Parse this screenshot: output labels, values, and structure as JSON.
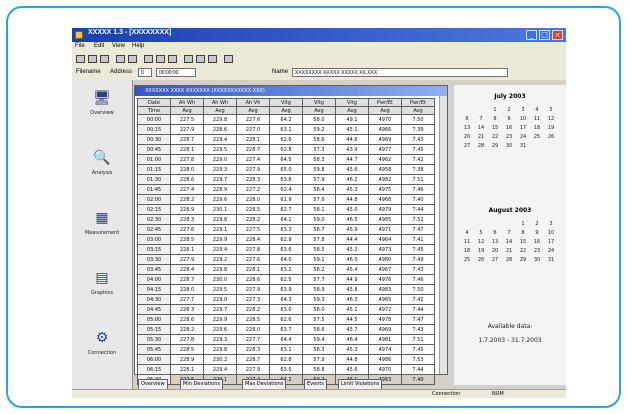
{
  "window": {
    "title": "XXXXX 1.3 - [XXXXXXXX]"
  },
  "menu": [
    "File",
    "Edit",
    "View",
    "Help"
  ],
  "address": {
    "label1": "Filename",
    "label2": "Address",
    "value1": "0",
    "value2": "00:00:00",
    "label3": "Name",
    "value3": "XXXXXXXX XXXXX XXXXX XX.XXX"
  },
  "nav": [
    {
      "label": "Overview",
      "icon": "computer-icon"
    },
    {
      "label": "Analysis",
      "icon": "magnifier-icon"
    },
    {
      "label": "Measurement",
      "icon": "instrument-icon"
    },
    {
      "label": "Graphics",
      "icon": "chart-icon"
    },
    {
      "label": "Connection",
      "icon": "network-icon"
    }
  ],
  "datawin_title": "XXXXXXX XXXX XXXXXXX (XXXXXXXXXXX.XXX)",
  "table": {
    "headers": [
      "Date",
      "Ah Wh",
      "Ah Wh",
      "Ah Vh",
      "Vltg",
      "Vltg",
      "Vltg",
      "Pwr/Et",
      "Pwr/Et"
    ],
    "units": [
      "Time",
      "Avg",
      "Avg",
      "Avg",
      "Avg",
      "Avg",
      "Avg",
      "Avg",
      "Avg"
    ],
    "rows": [
      [
        "00:00",
        "227.5",
        "229.8",
        "227.6",
        "64.2",
        "58.0",
        "49.1",
        "4970",
        "7.50"
      ],
      [
        "00:15",
        "227.9",
        "228.6",
        "227.0",
        "63.1",
        "59.2",
        "45.1",
        "4966",
        "7.39"
      ],
      [
        "00:30",
        "228.7",
        "229.4",
        "228.1",
        "62.6",
        "58.6",
        "44.6",
        "4969",
        "7.43"
      ],
      [
        "00:45",
        "228.1",
        "229.5",
        "228.7",
        "62.8",
        "57.3",
        "43.9",
        "4977",
        "7.45"
      ],
      [
        "01:00",
        "227.8",
        "229.0",
        "227.4",
        "64.5",
        "58.3",
        "44.7",
        "4962",
        "7.42"
      ],
      [
        "01:15",
        "228.0",
        "229.3",
        "227.9",
        "65.0",
        "59.8",
        "45.6",
        "4958",
        "7.38"
      ],
      [
        "01:30",
        "228.6",
        "229.7",
        "228.3",
        "63.8",
        "57.9",
        "46.2",
        "4982",
        "7.51"
      ],
      [
        "01:45",
        "227.4",
        "228.9",
        "227.2",
        "62.4",
        "58.4",
        "45.3",
        "4975",
        "7.46"
      ],
      [
        "02:00",
        "228.2",
        "229.6",
        "228.0",
        "61.9",
        "57.6",
        "44.8",
        "4968",
        "7.40"
      ],
      [
        "02:15",
        "228.9",
        "230.1",
        "228.5",
        "62.7",
        "58.1",
        "45.0",
        "4979",
        "7.44"
      ],
      [
        "02:30",
        "228.3",
        "229.8",
        "228.2",
        "64.1",
        "59.0",
        "46.5",
        "4985",
        "7.52"
      ],
      [
        "02:45",
        "227.6",
        "229.1",
        "227.5",
        "63.3",
        "58.7",
        "45.9",
        "4971",
        "7.47"
      ],
      [
        "03:00",
        "228.5",
        "229.9",
        "228.4",
        "62.9",
        "57.8",
        "44.4",
        "4964",
        "7.41"
      ],
      [
        "03:15",
        "228.1",
        "229.4",
        "227.8",
        "63.6",
        "58.5",
        "45.2",
        "4973",
        "7.45"
      ],
      [
        "03:30",
        "227.9",
        "229.2",
        "227.6",
        "64.0",
        "59.1",
        "46.0",
        "4980",
        "7.49"
      ],
      [
        "03:45",
        "228.4",
        "229.8",
        "228.1",
        "63.2",
        "58.2",
        "45.4",
        "4967",
        "7.43"
      ],
      [
        "04:00",
        "228.7",
        "230.0",
        "228.6",
        "62.5",
        "57.7",
        "44.9",
        "4976",
        "7.46"
      ],
      [
        "04:15",
        "228.0",
        "229.5",
        "227.9",
        "63.9",
        "58.9",
        "45.8",
        "4983",
        "7.50"
      ],
      [
        "04:30",
        "227.7",
        "229.0",
        "227.3",
        "64.3",
        "59.3",
        "46.3",
        "4965",
        "7.42"
      ],
      [
        "04:45",
        "228.3",
        "229.7",
        "228.2",
        "63.0",
        "58.0",
        "45.1",
        "4972",
        "7.44"
      ],
      [
        "05:00",
        "228.6",
        "229.9",
        "228.5",
        "62.6",
        "57.5",
        "44.5",
        "4978",
        "7.47"
      ],
      [
        "05:15",
        "228.2",
        "229.6",
        "228.0",
        "63.7",
        "58.6",
        "45.7",
        "4969",
        "7.43"
      ],
      [
        "05:30",
        "227.8",
        "229.3",
        "227.7",
        "64.4",
        "59.4",
        "46.4",
        "4981",
        "7.51"
      ],
      [
        "05:45",
        "228.5",
        "229.8",
        "228.3",
        "63.1",
        "58.3",
        "45.3",
        "4974",
        "7.45"
      ],
      [
        "06:00",
        "228.9",
        "230.2",
        "228.7",
        "62.8",
        "57.9",
        "44.8",
        "4986",
        "7.53"
      ],
      [
        "06:15",
        "228.1",
        "229.4",
        "227.9",
        "63.5",
        "58.8",
        "45.6",
        "4970",
        "7.44"
      ],
      [
        "06:30",
        "227.6",
        "229.1",
        "227.4",
        "64.2",
        "59.2",
        "46.1",
        "4963",
        "7.40"
      ]
    ]
  },
  "bottom_tabs": [
    "Overview",
    "Min Deviations",
    "Max Deviations",
    "Events",
    "Limit Violations"
  ],
  "calendar1": {
    "month": "July 2003",
    "days": [
      "",
      "",
      "1",
      "2",
      "3",
      "4",
      "5",
      "6",
      "7",
      "8",
      "9",
      "10",
      "11",
      "12",
      "13",
      "14",
      "15",
      "16",
      "17",
      "18",
      "19",
      "20",
      "21",
      "22",
      "23",
      "24",
      "25",
      "26",
      "27",
      "28",
      "29",
      "30",
      "31",
      "",
      ""
    ]
  },
  "calendar2": {
    "month": "August 2003",
    "days": [
      "",
      "",
      "",
      "",
      "1",
      "2",
      "3",
      "4",
      "5",
      "6",
      "7",
      "8",
      "9",
      "10",
      "11",
      "12",
      "13",
      "14",
      "15",
      "16",
      "17",
      "18",
      "19",
      "20",
      "21",
      "22",
      "23",
      "24",
      "25",
      "26",
      "27",
      "28",
      "29",
      "30",
      "31"
    ]
  },
  "status": {
    "line1": "Available data:",
    "line2": "1.7.2003 - 31.7.2003",
    "right": "Connection",
    "num": "NUM"
  }
}
